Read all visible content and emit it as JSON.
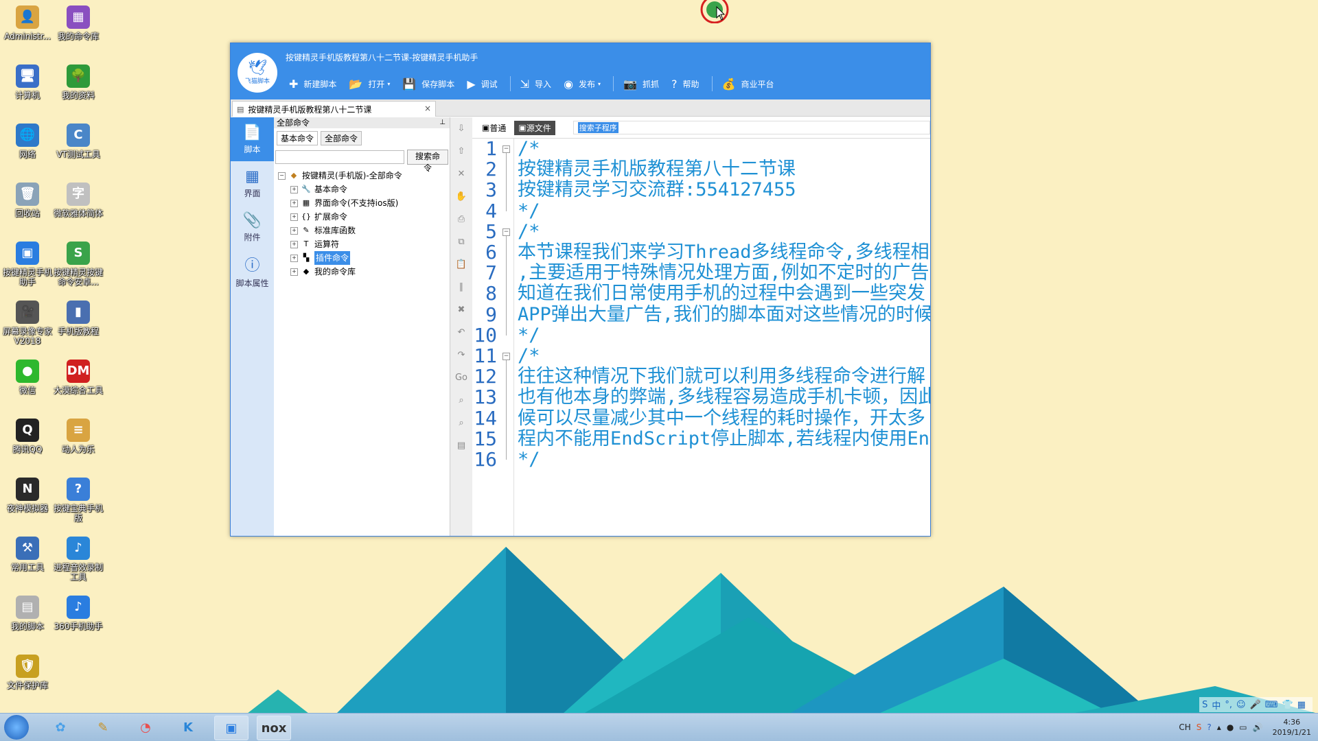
{
  "desktop": {
    "icons": [
      {
        "label": "Administr...",
        "color": "#d9a441",
        "glyph": "👤"
      },
      {
        "label": "我的命令库",
        "color": "#8a4fc0",
        "glyph": "▦"
      },
      {
        "label": "计算机",
        "color": "#3a6fc8",
        "glyph": "🖥"
      },
      {
        "label": "我的资料",
        "color": "#2e9a3a",
        "glyph": "🌳"
      },
      {
        "label": "网络",
        "color": "#2e79c9",
        "glyph": "🌐"
      },
      {
        "label": "VT测试工具",
        "color": "#4a86c8",
        "glyph": "C"
      },
      {
        "label": "回收站",
        "color": "#8aa3b8",
        "glyph": "🗑"
      },
      {
        "label": "微软雅体简体",
        "color": "#c0c0c0",
        "glyph": "字"
      },
      {
        "label": "按键精灵手机助手",
        "color": "#2a7de0",
        "glyph": "▣"
      },
      {
        "label": "按键精灵按键命令安卓...",
        "color": "#3aa34a",
        "glyph": "S"
      },
      {
        "label": "屏幕录像专家V2018",
        "color": "#555555",
        "glyph": "🎥"
      },
      {
        "label": "手机版教程",
        "color": "#4a6fb0",
        "glyph": "▮"
      },
      {
        "label": "微信",
        "color": "#2eb82e",
        "glyph": "●"
      },
      {
        "label": "大漠综合工具",
        "color": "#d02020",
        "glyph": "DM"
      },
      {
        "label": "腾讯QQ",
        "color": "#222222",
        "glyph": "Q"
      },
      {
        "label": "动人为乐",
        "color": "#d9a441",
        "glyph": "≡"
      },
      {
        "label": "夜神模拟器",
        "color": "#2a2a2a",
        "glyph": "N"
      },
      {
        "label": "按键宝典手机版",
        "color": "#3a7fd8",
        "glyph": "?"
      },
      {
        "label": "常用工具",
        "color": "#3a6fb8",
        "glyph": "⚒"
      },
      {
        "label": "进程音效录制工具",
        "color": "#2a86d8",
        "glyph": "♪"
      },
      {
        "label": "我的脚本",
        "color": "#b0b0b0",
        "glyph": "▤"
      },
      {
        "label": "360手机助手",
        "color": "#2a7de0",
        "glyph": "♪"
      },
      {
        "label": "文件保护库",
        "color": "#c8a020",
        "glyph": "🛡"
      }
    ]
  },
  "window": {
    "title": "按键精灵手机版教程第八十二节课-按键精灵手机助手",
    "logo_text": "飞猫脚本",
    "toolbar": [
      {
        "label": "新建脚本",
        "icon": "plus-icon",
        "glyph": "✚",
        "caret": ""
      },
      {
        "label": "打开",
        "icon": "folder-icon",
        "glyph": "📂",
        "caret": "▾"
      },
      {
        "label": "保存脚本",
        "icon": "save-icon",
        "glyph": "💾",
        "caret": ""
      },
      {
        "label": "调试",
        "icon": "play-icon",
        "glyph": "▶",
        "caret": ""
      },
      {
        "label": "导入",
        "icon": "import-icon",
        "glyph": "⇲",
        "caret": ""
      },
      {
        "label": "发布",
        "icon": "publish-icon",
        "glyph": "◉",
        "caret": "▾"
      },
      {
        "label": "抓抓",
        "icon": "camera-icon",
        "glyph": "📷",
        "caret": ""
      },
      {
        "label": "帮助",
        "icon": "help-icon",
        "glyph": "?",
        "caret": ""
      },
      {
        "label": "商业平台",
        "icon": "bag-icon",
        "glyph": "💰",
        "caret": ""
      }
    ],
    "doc_tab": {
      "label": "按键精灵手机版教程第八十二节课",
      "close": "×"
    },
    "leftnav": [
      {
        "label": "脚本",
        "glyph": "📄",
        "active": true
      },
      {
        "label": "界面",
        "glyph": "▦",
        "active": false
      },
      {
        "label": "附件",
        "glyph": "📎",
        "active": false
      },
      {
        "label": "脚本属性",
        "glyph": "ⓘ",
        "active": false
      }
    ],
    "cmdpanel": {
      "header": "全部命令",
      "pin": "⊥",
      "tabs": [
        "基本命令",
        "全部命令"
      ],
      "search_value": "",
      "search_button": "搜索命令",
      "tree_root": "按键精灵(手机版)-全部命令",
      "tree_children": [
        {
          "label": "基本命令",
          "glyph": "🔧",
          "selected": false
        },
        {
          "label": "界面命令(不支持ios版)",
          "glyph": "▦",
          "selected": false
        },
        {
          "label": "扩展命令",
          "glyph": "{}",
          "selected": false
        },
        {
          "label": "标准库函数",
          "glyph": "✎",
          "selected": false
        },
        {
          "label": "运算符",
          "glyph": "T",
          "selected": false
        },
        {
          "label": "插件命令",
          "glyph": "▚",
          "selected": true
        },
        {
          "label": "我的命令库",
          "glyph": "◆",
          "selected": false
        }
      ]
    },
    "toolstrip": [
      "⇩",
      "⇧",
      "✕",
      "✋",
      "⎙",
      "⧉",
      "📋",
      "∥",
      "✖",
      "↶",
      "↷",
      "Go",
      "⌕",
      "⌕",
      "▤"
    ],
    "editor": {
      "tabs": [
        {
          "label": "普通",
          "active": false
        },
        {
          "label": "源文件",
          "active": true
        }
      ],
      "proc_select": "搜索子程序",
      "lines": [
        {
          "n": "1",
          "text": "/*"
        },
        {
          "n": "2",
          "text": "按键精灵手机版教程第八十二节课"
        },
        {
          "n": "3",
          "text": "按键精灵学习交流群:554127455"
        },
        {
          "n": "4",
          "text": "*/"
        },
        {
          "n": "5",
          "text": "/*"
        },
        {
          "n": "6",
          "text": "本节课程我们来学习Thread多线程命令,多线程相"
        },
        {
          "n": "7",
          "text": ",主要适用于特殊情况处理方面,例如不定时的广告"
        },
        {
          "n": "8",
          "text": "知道在我们日常使用手机的过程中会遇到一些突发"
        },
        {
          "n": "9",
          "text": "APP弹出大量广告,我们的脚本面对这些情况的时候"
        },
        {
          "n": "10",
          "text": "*/"
        },
        {
          "n": "11",
          "text": "/*"
        },
        {
          "n": "12",
          "text": "往往这种情况下我们就可以利用多线程命令进行解"
        },
        {
          "n": "13",
          "text": "也有他本身的弊端,多线程容易造成手机卡顿，因此"
        },
        {
          "n": "14",
          "text": "候可以尽量减少其中一个线程的耗时操作，开太多"
        },
        {
          "n": "15",
          "text": "程内不能用EndScript停止脚本,若线程内使用En"
        },
        {
          "n": "16",
          "text": "*/"
        }
      ]
    }
  },
  "taskbar": {
    "apps": [
      {
        "glyph": "✿",
        "color": "#4aa0e8",
        "active": false
      },
      {
        "glyph": "✎",
        "color": "#c89020",
        "active": false
      },
      {
        "glyph": "◔",
        "color": "#e85050",
        "active": false
      },
      {
        "glyph": "K",
        "color": "#2a86d8",
        "active": false
      },
      {
        "glyph": "▣",
        "color": "#2a7de0",
        "active": true
      },
      {
        "glyph": "nox",
        "color": "#333333",
        "active": true
      }
    ],
    "tray_lang": "CH",
    "clock_time": "4:36",
    "clock_date": "2019/1/21",
    "ime": [
      "S",
      "中",
      "°,",
      "☺",
      "🎤",
      "⌨",
      "👕",
      "▦"
    ]
  },
  "colors": {
    "accent": "#3b8ee8",
    "code_text": "#1e90d4",
    "desktop_bg": "#fbf0c2"
  }
}
